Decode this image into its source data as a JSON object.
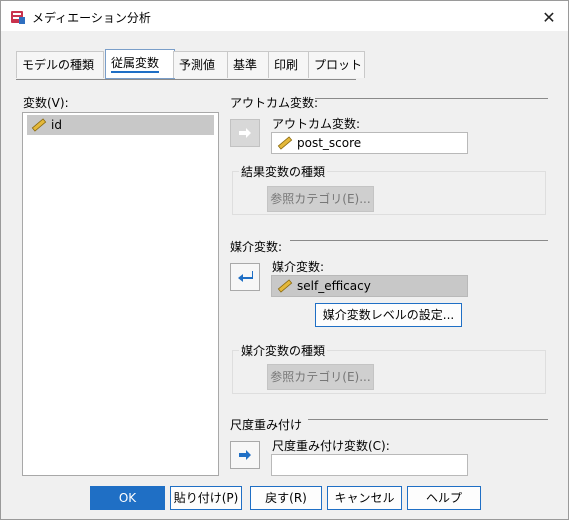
{
  "window": {
    "title": "メディエーション分析"
  },
  "tabs": [
    "モデルの種類",
    "従属変数",
    "予測値",
    "基準",
    "印刷",
    "プロット"
  ],
  "variables": {
    "label": "変数(V):",
    "items": [
      "id"
    ]
  },
  "outcome": {
    "section_label": "アウトカム変数:",
    "field_label": "アウトカム変数:",
    "value": "post_score",
    "type_group": "結果変数の種類",
    "ref_button": "参照カテゴリ(E)..."
  },
  "mediator": {
    "section_label": "媒介変数:",
    "field_label": "媒介変数:",
    "value": "self_efficacy",
    "level_button": "媒介変数レベルの設定...",
    "type_group": "媒介変数の種類",
    "ref_button": "参照カテゴリ(E)..."
  },
  "weight": {
    "section_label": "尺度重み付け",
    "field_label": "尺度重み付け変数(C):",
    "value": ""
  },
  "buttons": {
    "ok": "OK",
    "paste": "貼り付け(P)",
    "reset": "戻す(R)",
    "cancel": "キャンセル",
    "help": "ヘルプ"
  }
}
